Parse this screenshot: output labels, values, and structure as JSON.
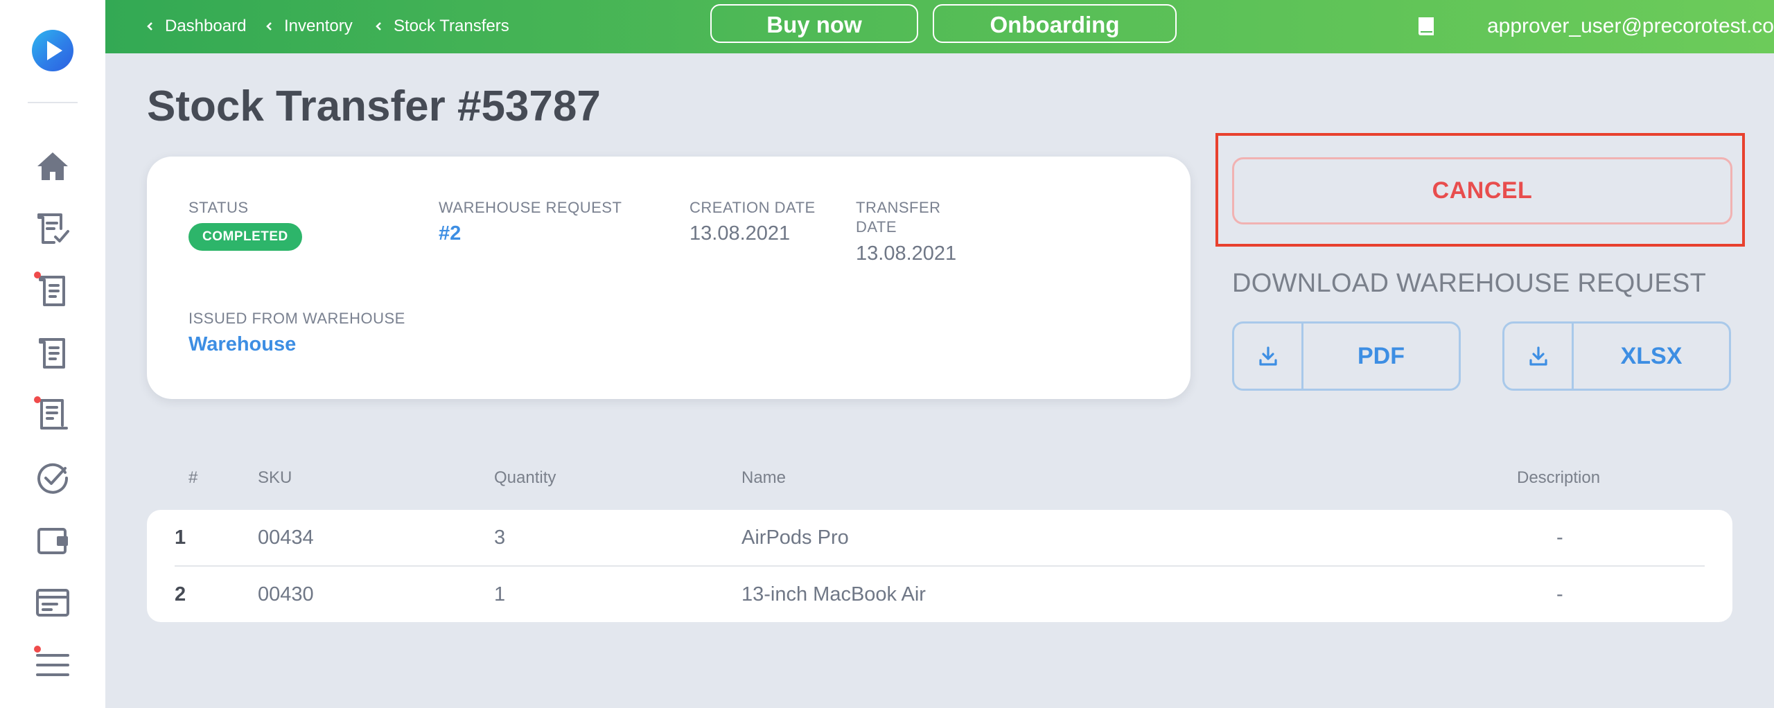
{
  "header": {
    "breadcrumbs": [
      "Dashboard",
      "Inventory",
      "Stock Transfers"
    ],
    "buy_now_label": "Buy now",
    "onboarding_label": "Onboarding",
    "user_email": "approver_user@precorotest.com"
  },
  "sidebar": {
    "items": [
      {
        "icon": "home-icon",
        "badge": false
      },
      {
        "icon": "approved-document-icon",
        "badge": false
      },
      {
        "icon": "document-icon",
        "badge": true
      },
      {
        "icon": "document-icon",
        "badge": false
      },
      {
        "icon": "receipt-icon",
        "badge": true
      },
      {
        "icon": "check-circle-icon",
        "badge": false
      },
      {
        "icon": "wallet-icon",
        "badge": false
      },
      {
        "icon": "card-icon",
        "badge": false
      },
      {
        "icon": "list-icon",
        "badge": true
      }
    ]
  },
  "page": {
    "title": "Stock Transfer #53787"
  },
  "details": {
    "status_label": "STATUS",
    "status_value": "COMPLETED",
    "warehouse_request_label": "WAREHOUSE REQUEST",
    "warehouse_request_value": "#2",
    "creation_date_label": "CREATION DATE",
    "creation_date_value": "13.08.2021",
    "transfer_date_label_line1": "TRANSFER",
    "transfer_date_label_line2": "DATE",
    "transfer_date_value": "13.08.2021",
    "issued_from_label": "ISSUED FROM WAREHOUSE",
    "issued_from_value": "Warehouse"
  },
  "actions": {
    "cancel_label": "CANCEL",
    "download_title": "DOWNLOAD WAREHOUSE REQUEST",
    "pdf_label": "PDF",
    "xlsx_label": "XLSX"
  },
  "table": {
    "columns": [
      "#",
      "SKU",
      "Quantity",
      "Name",
      "Description"
    ],
    "rows": [
      {
        "num": "1",
        "sku": "00434",
        "quantity": "3",
        "name": "AirPods Pro",
        "description": "-"
      },
      {
        "num": "2",
        "sku": "00430",
        "quantity": "1",
        "name": "13-inch MacBook Air",
        "description": "-"
      }
    ]
  },
  "colors": {
    "header_green": "#52bb56",
    "status_green": "#2db56a",
    "link_blue": "#3d8ee3",
    "cancel_red": "#e84d4d",
    "highlight_red": "#e8412e"
  }
}
